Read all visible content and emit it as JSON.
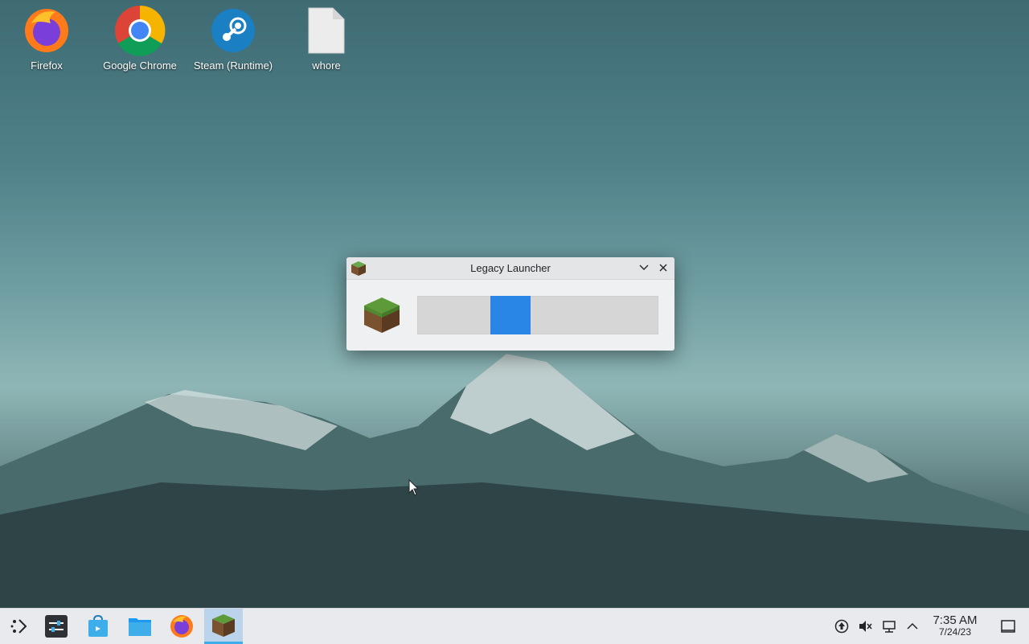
{
  "desktop": {
    "icons": [
      {
        "label": "Firefox",
        "icon": "firefox-icon"
      },
      {
        "label": "Google Chrome",
        "icon": "chrome-icon"
      },
      {
        "label": "Steam (Runtime)",
        "icon": "steam-icon"
      },
      {
        "label": "whore",
        "icon": "file-icon"
      }
    ]
  },
  "window": {
    "title": "Legacy Launcher",
    "icon": "minecraft-grass-block-icon",
    "progress_indeterminate": true
  },
  "taskbar": {
    "items": [
      {
        "name": "application-launcher",
        "icon": "launcher-icon"
      },
      {
        "name": "system-settings",
        "icon": "settings-icon"
      },
      {
        "name": "discover",
        "icon": "store-icon"
      },
      {
        "name": "file-manager",
        "icon": "folder-icon"
      },
      {
        "name": "firefox",
        "icon": "firefox-icon"
      },
      {
        "name": "legacy-launcher",
        "icon": "minecraft-grass-block-icon",
        "active": true
      }
    ],
    "tray": [
      "update-icon",
      "volume-muted-icon",
      "network-icon",
      "tray-expand-icon"
    ],
    "clock": {
      "time": "7:35 AM",
      "date": "7/24/23"
    },
    "show_desktop_icon": "show-desktop-icon"
  },
  "colors": {
    "accent": "#2a86e6",
    "taskbar": "#e8eaed"
  }
}
